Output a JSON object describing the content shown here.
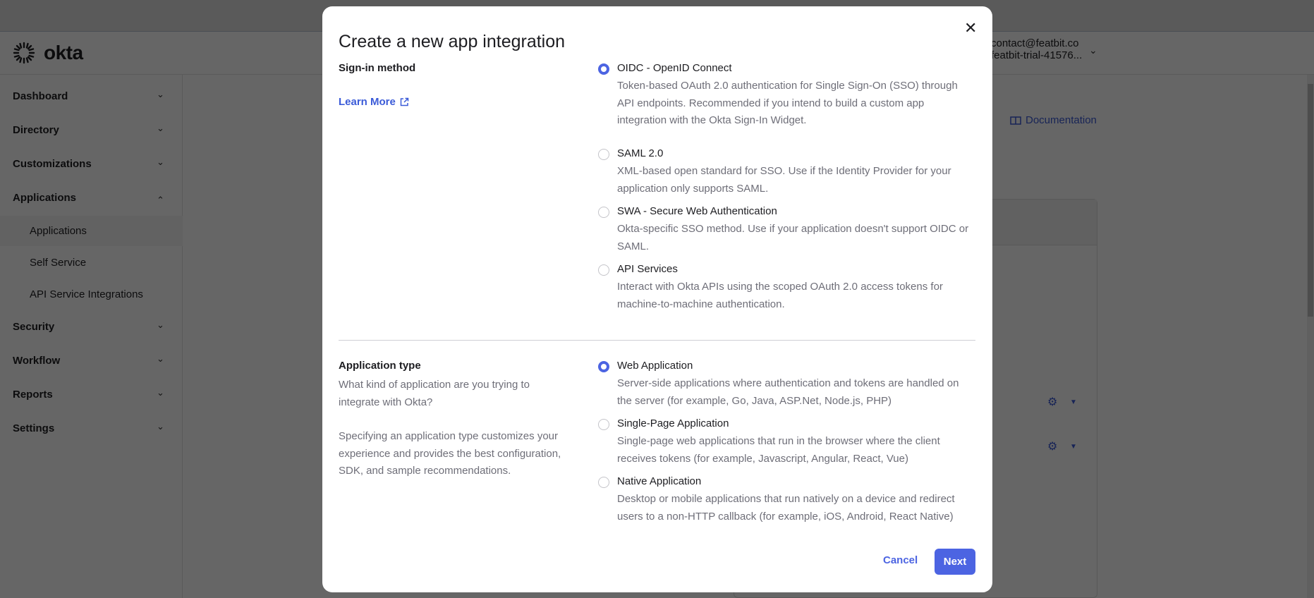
{
  "header": {
    "logo_text": "okta",
    "user_email": "contact@featbit.co",
    "user_org": "featbit-trial-41576..."
  },
  "sidebar": {
    "items": [
      {
        "label": "Dashboard",
        "expanded": false
      },
      {
        "label": "Directory",
        "expanded": false
      },
      {
        "label": "Customizations",
        "expanded": false
      },
      {
        "label": "Applications",
        "expanded": true
      },
      {
        "label": "Security",
        "expanded": false
      },
      {
        "label": "Workflow",
        "expanded": false
      },
      {
        "label": "Reports",
        "expanded": false
      },
      {
        "label": "Settings",
        "expanded": false
      }
    ],
    "subitems": [
      {
        "label": "Applications",
        "active": true
      },
      {
        "label": "Self Service",
        "active": false
      },
      {
        "label": "API Service Integrations",
        "active": false
      }
    ]
  },
  "main": {
    "documentation_label": "Documentation"
  },
  "modal": {
    "title": "Create a new app integration",
    "sign_in": {
      "label": "Sign-in method",
      "learn_more": "Learn More",
      "options": [
        {
          "label": "OIDC - OpenID Connect",
          "selected": true,
          "desc": "Token-based OAuth 2.0 authentication for Single Sign-On (SSO) through API endpoints. Recommended if you intend to build a custom app integration with the Okta Sign-In Widget."
        },
        {
          "label": "SAML 2.0",
          "selected": false,
          "desc": "XML-based open standard for SSO. Use if the Identity Provider for your application only supports SAML."
        },
        {
          "label": "SWA - Secure Web Authentication",
          "selected": false,
          "desc": "Okta-specific SSO method. Use if your application doesn't support OIDC or SAML."
        },
        {
          "label": "API Services",
          "selected": false,
          "desc": "Interact with Okta APIs using the scoped OAuth 2.0 access tokens for machine-to-machine authentication."
        }
      ]
    },
    "app_type": {
      "label": "Application type",
      "question": "What kind of application are you trying to integrate with Okta?",
      "note": "Specifying an application type customizes your experience and provides the best configuration, SDK, and sample recommendations.",
      "options": [
        {
          "label": "Web Application",
          "selected": true,
          "desc": "Server-side applications where authentication and tokens are handled on the server (for example, Go, Java, ASP.Net, Node.js, PHP)"
        },
        {
          "label": "Single-Page Application",
          "selected": false,
          "desc": "Single-page web applications that run in the browser where the client receives tokens (for example, Javascript, Angular, React, Vue)"
        },
        {
          "label": "Native Application",
          "selected": false,
          "desc": "Desktop or mobile applications that run natively on a device and redirect users to a non-HTTP callback (for example, iOS, Android, React Native)"
        }
      ]
    },
    "cancel_label": "Cancel",
    "next_label": "Next"
  },
  "colors": {
    "accent": "#4c64e2",
    "link": "#3b5bd8"
  }
}
